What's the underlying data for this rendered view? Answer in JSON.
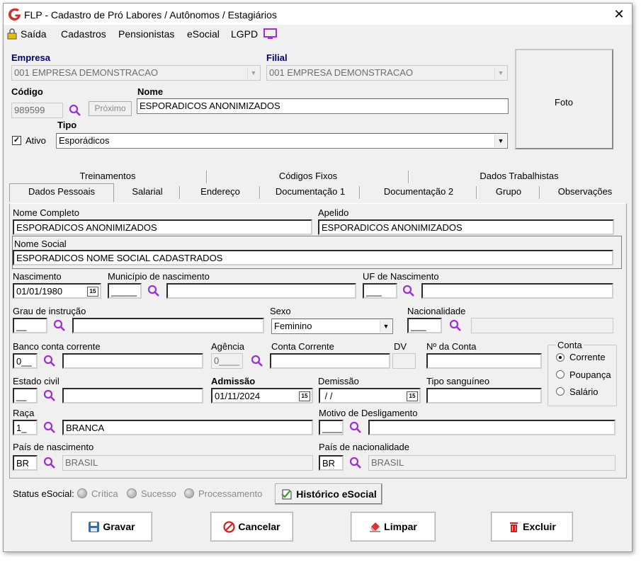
{
  "window": {
    "title": "FLP - Cadastro de Pró Labores / Autônomos / Estagiários",
    "close": "✕"
  },
  "menu": {
    "saida": "Saída",
    "cadastros": "Cadastros",
    "pensionistas": "Pensionistas",
    "esocial": "eSocial",
    "lgpd": "LGPD"
  },
  "header": {
    "empresa_label": "Empresa",
    "empresa_value": "001 EMPRESA DEMONSTRACAO",
    "filial_label": "Filial",
    "filial_value": "001 EMPRESA DEMONSTRACAO",
    "codigo_label": "Código",
    "codigo_value": "989599",
    "proximo": "Próximo",
    "nome_label": "Nome",
    "nome_value": "ESPORADICOS ANONIMIZADOS",
    "ativo_label": "Ativo",
    "ativo_checked": true,
    "tipo_label": "Tipo",
    "tipo_value": "Esporádicos",
    "foto_label": "Foto"
  },
  "tabs": {
    "row1": [
      "Treinamentos",
      "Códigos Fixos",
      "Dados Trabalhistas"
    ],
    "row2": [
      "Dados Pessoais",
      "Salarial",
      "Endereço",
      "Documentação 1",
      "Documentação 2",
      "Grupo",
      "Observações"
    ],
    "active": "Dados Pessoais"
  },
  "form": {
    "nome_completo_label": "Nome Completo",
    "nome_completo": "ESPORADICOS ANONIMIZADOS",
    "apelido_label": "Apelido",
    "apelido": "ESPORADICOS ANONIMIZADOS",
    "nome_social_label": "Nome Social",
    "nome_social": "ESPORADICOS NOME SOCIAL CADASTRADOS",
    "nascimento_label": "Nascimento",
    "nascimento": "01/01/1980",
    "municipio_label": "Município de nascimento",
    "municipio_code": "_____",
    "uf_label": "UF de Nascimento",
    "uf_code": "___",
    "grau_label": "Grau de instrução",
    "grau_code": "__",
    "sexo_label": "Sexo",
    "sexo": "Feminino",
    "nacionalidade_label": "Nacionalidade",
    "nacionalidade_code": "___",
    "banco_label": "Banco conta corrente",
    "banco_code": "0__",
    "agencia_label": "Agência",
    "agencia_code": "0____",
    "conta_corrente_label": "Conta Corrente",
    "dv_label": "DV",
    "numero_conta_label": "Nº da Conta",
    "conta_group": "Conta",
    "conta_options": [
      "Corrente",
      "Poupança",
      "Salário"
    ],
    "conta_selected": "Corrente",
    "estado_civil_label": "Estado civil",
    "estado_civil_code": "__",
    "admissao_label": "Admissão",
    "admissao": "01/11/2024",
    "demissao_label": "Demissão",
    "demissao": " / /",
    "tipo_sanguineo_label": "Tipo sanguíneo",
    "raca_label": "Raça",
    "raca_code": "1_",
    "raca_name": "BRANCA",
    "motivo_label": "Motivo de Desligamento",
    "motivo_code": "____",
    "pais_nasc_label": "País de nascimento",
    "pais_nasc_code": "BR",
    "pais_nasc_name": "BRASIL",
    "pais_nac_label": "País de nacionalidade",
    "pais_nac_code": "BR",
    "pais_nac_name": "BRASIL"
  },
  "status": {
    "label": "Status eSocial:",
    "critica": "Crítica",
    "sucesso": "Sucesso",
    "processamento": "Processamento",
    "historico": "Histórico eSocial"
  },
  "buttons": {
    "gravar": "Gravar",
    "cancelar": "Cancelar",
    "limpar": "Limpar",
    "excluir": "Excluir"
  },
  "colors": {
    "accent_purple": "#9b30d9",
    "label_blue": "#00007a",
    "highlight_red": "#d9534f"
  }
}
